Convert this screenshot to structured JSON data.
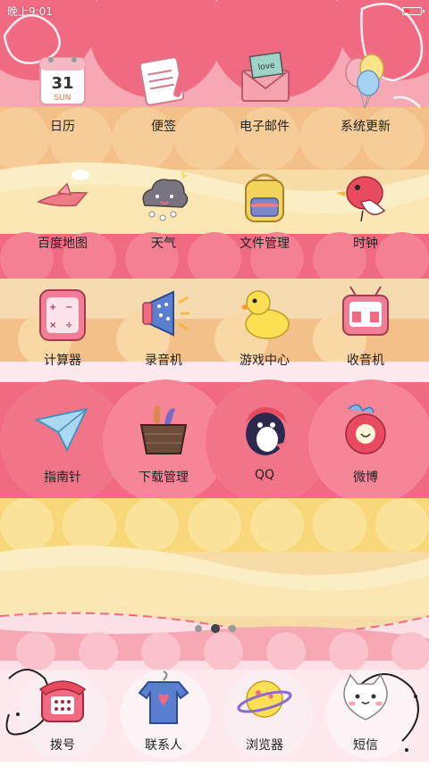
{
  "status_bar": {
    "time": "晚上9:01"
  },
  "theme_colors": {
    "pink": "#f06a82",
    "light_pink": "#f7a8b5",
    "peach": "#f3c089",
    "cream": "#fbe7b4",
    "yellow": "#f8d87a",
    "white_pink": "#fde9ee"
  },
  "apps": [
    {
      "label": "日历",
      "icon": "calendar-icon",
      "date_number": "31",
      "date_day": "SUN"
    },
    {
      "label": "便签",
      "icon": "notes-icon"
    },
    {
      "label": "电子邮件",
      "icon": "email-icon",
      "stamp_text": "love"
    },
    {
      "label": "系统更新",
      "icon": "balloons-icon"
    },
    {
      "label": "百度地图",
      "icon": "paper-plane-map-icon"
    },
    {
      "label": "天气",
      "icon": "cloud-weather-icon"
    },
    {
      "label": "文件管理",
      "icon": "backpack-icon"
    },
    {
      "label": "时钟",
      "icon": "bird-clock-icon"
    },
    {
      "label": "计算器",
      "icon": "calculator-icon"
    },
    {
      "label": "录音机",
      "icon": "megaphone-icon"
    },
    {
      "label": "游戏中心",
      "icon": "duck-icon"
    },
    {
      "label": "收音机",
      "icon": "tv-radio-icon"
    },
    {
      "label": "指南针",
      "icon": "paper-airplane-icon"
    },
    {
      "label": "下载管理",
      "icon": "basket-icon"
    },
    {
      "label": "QQ",
      "icon": "penguin-icon"
    },
    {
      "label": "微博",
      "icon": "flower-weibo-icon"
    }
  ],
  "page_indicator": {
    "pages": 3,
    "current": 2
  },
  "dock": [
    {
      "label": "拨号",
      "icon": "telephone-icon"
    },
    {
      "label": "联系人",
      "icon": "shirt-contacts-icon"
    },
    {
      "label": "浏览器",
      "icon": "planet-browser-icon"
    },
    {
      "label": "短信",
      "icon": "cat-message-icon"
    }
  ]
}
